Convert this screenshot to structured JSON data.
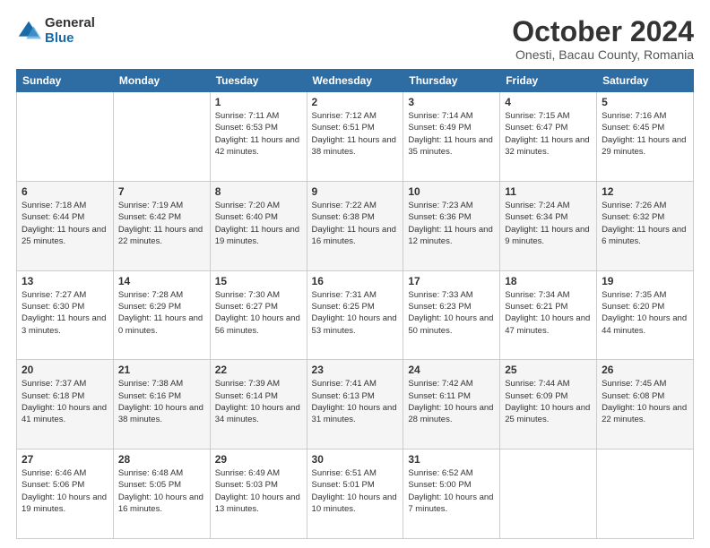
{
  "logo": {
    "general": "General",
    "blue": "Blue"
  },
  "header": {
    "month": "October 2024",
    "location": "Onesti, Bacau County, Romania"
  },
  "weekdays": [
    "Sunday",
    "Monday",
    "Tuesday",
    "Wednesday",
    "Thursday",
    "Friday",
    "Saturday"
  ],
  "weeks": [
    [
      {
        "day": "",
        "info": ""
      },
      {
        "day": "",
        "info": ""
      },
      {
        "day": "1",
        "info": "Sunrise: 7:11 AM\nSunset: 6:53 PM\nDaylight: 11 hours and 42 minutes."
      },
      {
        "day": "2",
        "info": "Sunrise: 7:12 AM\nSunset: 6:51 PM\nDaylight: 11 hours and 38 minutes."
      },
      {
        "day": "3",
        "info": "Sunrise: 7:14 AM\nSunset: 6:49 PM\nDaylight: 11 hours and 35 minutes."
      },
      {
        "day": "4",
        "info": "Sunrise: 7:15 AM\nSunset: 6:47 PM\nDaylight: 11 hours and 32 minutes."
      },
      {
        "day": "5",
        "info": "Sunrise: 7:16 AM\nSunset: 6:45 PM\nDaylight: 11 hours and 29 minutes."
      }
    ],
    [
      {
        "day": "6",
        "info": "Sunrise: 7:18 AM\nSunset: 6:44 PM\nDaylight: 11 hours and 25 minutes."
      },
      {
        "day": "7",
        "info": "Sunrise: 7:19 AM\nSunset: 6:42 PM\nDaylight: 11 hours and 22 minutes."
      },
      {
        "day": "8",
        "info": "Sunrise: 7:20 AM\nSunset: 6:40 PM\nDaylight: 11 hours and 19 minutes."
      },
      {
        "day": "9",
        "info": "Sunrise: 7:22 AM\nSunset: 6:38 PM\nDaylight: 11 hours and 16 minutes."
      },
      {
        "day": "10",
        "info": "Sunrise: 7:23 AM\nSunset: 6:36 PM\nDaylight: 11 hours and 12 minutes."
      },
      {
        "day": "11",
        "info": "Sunrise: 7:24 AM\nSunset: 6:34 PM\nDaylight: 11 hours and 9 minutes."
      },
      {
        "day": "12",
        "info": "Sunrise: 7:26 AM\nSunset: 6:32 PM\nDaylight: 11 hours and 6 minutes."
      }
    ],
    [
      {
        "day": "13",
        "info": "Sunrise: 7:27 AM\nSunset: 6:30 PM\nDaylight: 11 hours and 3 minutes."
      },
      {
        "day": "14",
        "info": "Sunrise: 7:28 AM\nSunset: 6:29 PM\nDaylight: 11 hours and 0 minutes."
      },
      {
        "day": "15",
        "info": "Sunrise: 7:30 AM\nSunset: 6:27 PM\nDaylight: 10 hours and 56 minutes."
      },
      {
        "day": "16",
        "info": "Sunrise: 7:31 AM\nSunset: 6:25 PM\nDaylight: 10 hours and 53 minutes."
      },
      {
        "day": "17",
        "info": "Sunrise: 7:33 AM\nSunset: 6:23 PM\nDaylight: 10 hours and 50 minutes."
      },
      {
        "day": "18",
        "info": "Sunrise: 7:34 AM\nSunset: 6:21 PM\nDaylight: 10 hours and 47 minutes."
      },
      {
        "day": "19",
        "info": "Sunrise: 7:35 AM\nSunset: 6:20 PM\nDaylight: 10 hours and 44 minutes."
      }
    ],
    [
      {
        "day": "20",
        "info": "Sunrise: 7:37 AM\nSunset: 6:18 PM\nDaylight: 10 hours and 41 minutes."
      },
      {
        "day": "21",
        "info": "Sunrise: 7:38 AM\nSunset: 6:16 PM\nDaylight: 10 hours and 38 minutes."
      },
      {
        "day": "22",
        "info": "Sunrise: 7:39 AM\nSunset: 6:14 PM\nDaylight: 10 hours and 34 minutes."
      },
      {
        "day": "23",
        "info": "Sunrise: 7:41 AM\nSunset: 6:13 PM\nDaylight: 10 hours and 31 minutes."
      },
      {
        "day": "24",
        "info": "Sunrise: 7:42 AM\nSunset: 6:11 PM\nDaylight: 10 hours and 28 minutes."
      },
      {
        "day": "25",
        "info": "Sunrise: 7:44 AM\nSunset: 6:09 PM\nDaylight: 10 hours and 25 minutes."
      },
      {
        "day": "26",
        "info": "Sunrise: 7:45 AM\nSunset: 6:08 PM\nDaylight: 10 hours and 22 minutes."
      }
    ],
    [
      {
        "day": "27",
        "info": "Sunrise: 6:46 AM\nSunset: 5:06 PM\nDaylight: 10 hours and 19 minutes."
      },
      {
        "day": "28",
        "info": "Sunrise: 6:48 AM\nSunset: 5:05 PM\nDaylight: 10 hours and 16 minutes."
      },
      {
        "day": "29",
        "info": "Sunrise: 6:49 AM\nSunset: 5:03 PM\nDaylight: 10 hours and 13 minutes."
      },
      {
        "day": "30",
        "info": "Sunrise: 6:51 AM\nSunset: 5:01 PM\nDaylight: 10 hours and 10 minutes."
      },
      {
        "day": "31",
        "info": "Sunrise: 6:52 AM\nSunset: 5:00 PM\nDaylight: 10 hours and 7 minutes."
      },
      {
        "day": "",
        "info": ""
      },
      {
        "day": "",
        "info": ""
      }
    ]
  ]
}
